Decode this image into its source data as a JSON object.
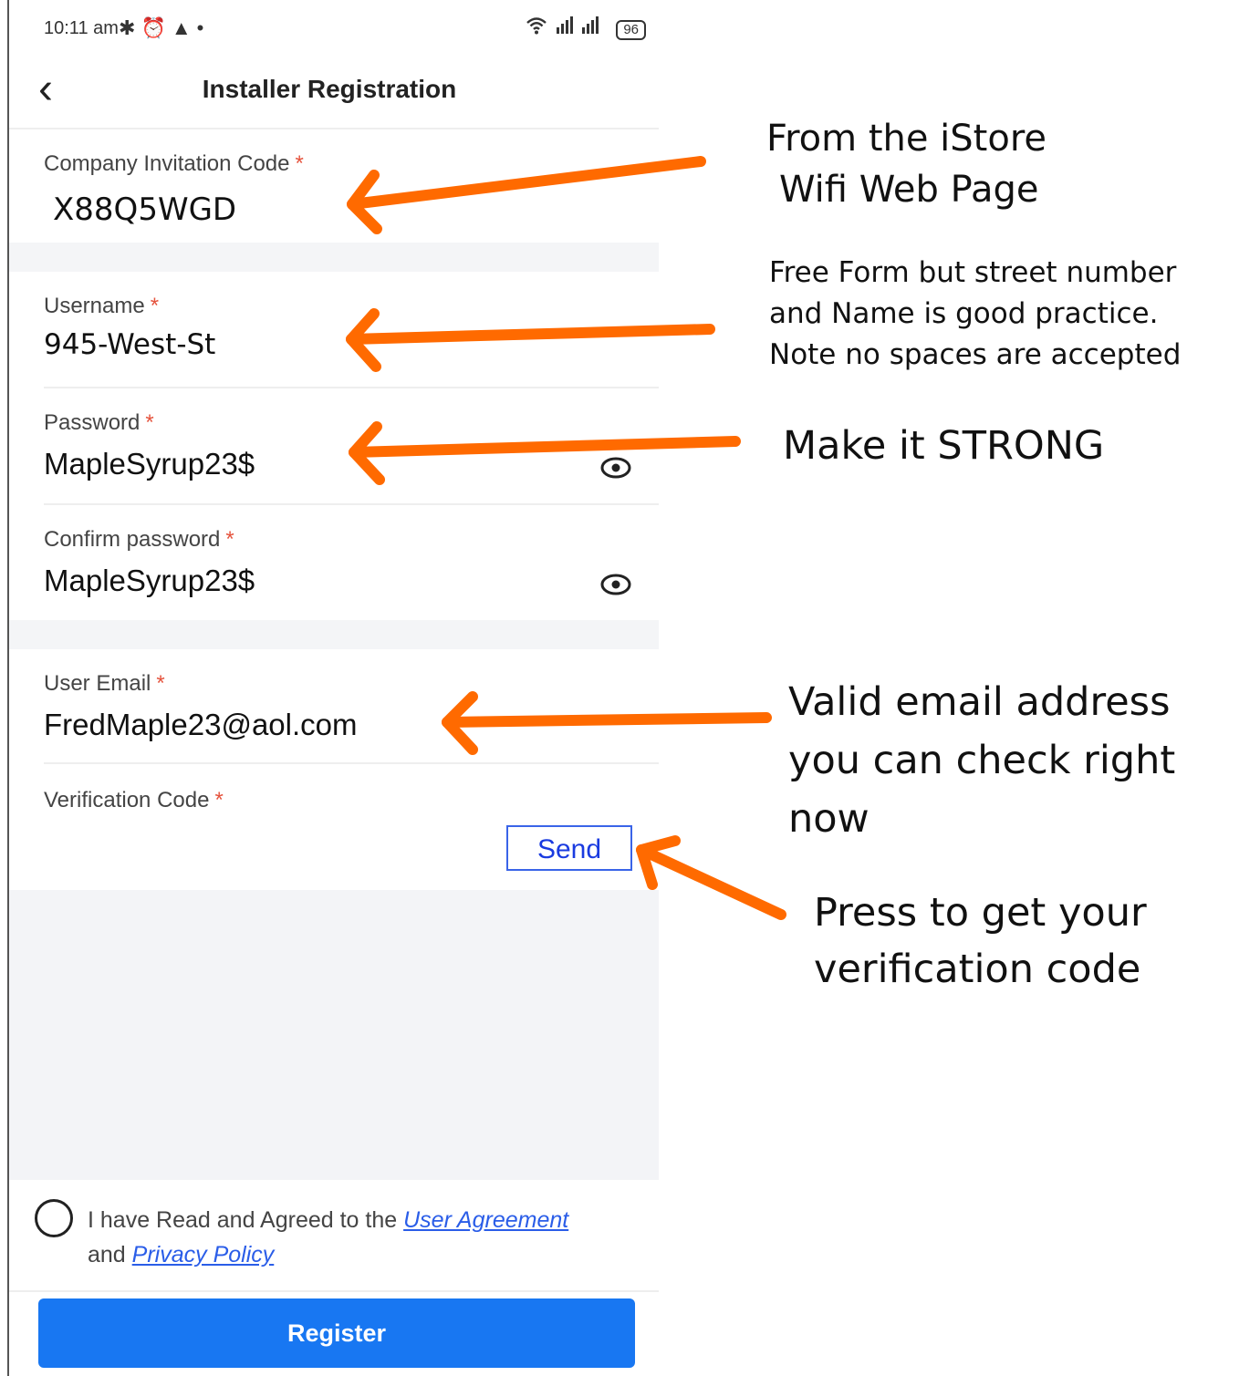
{
  "status_bar": {
    "time": "10:11 am",
    "battery": "96"
  },
  "header": {
    "title": "Installer Registration"
  },
  "form": {
    "invitation": {
      "label": "Company Invitation Code",
      "required_mark": "*",
      "value": "X88Q5WGD"
    },
    "username": {
      "label": "Username",
      "required_mark": "*",
      "value": "945-West-St"
    },
    "password": {
      "label": "Password",
      "required_mark": "*",
      "value": "MapleSyrup23$"
    },
    "confirm_password": {
      "label": "Confirm password",
      "required_mark": "*",
      "value": "MapleSyrup23$"
    },
    "email": {
      "label": "User Email",
      "required_mark": "*",
      "value": "FredMaple23@aol.com"
    },
    "verification": {
      "label": "Verification Code",
      "required_mark": "*",
      "send_label": "Send"
    }
  },
  "agreement": {
    "prefix": "I have Read and Agreed to the",
    "user_agreement": "User Agreement",
    "middle": "and",
    "privacy_policy": "Privacy Policy"
  },
  "register_label": "Register",
  "annotations": {
    "istore_line1": "From the iStore",
    "istore_line2": "Wifi Web Page",
    "username_line1": "Free Form but street number",
    "username_line2": "and Name is good practice.",
    "username_line3": "Note no spaces are accepted",
    "password": "Make it STRONG",
    "email_line1": "Valid email address",
    "email_line2": "you can check right now",
    "send_line1": "Press to get your",
    "send_line2": "verification code"
  },
  "colors": {
    "arrow": "#ff6a00",
    "primary": "#1877f2",
    "required": "#e5533d",
    "link": "#2a5de8"
  },
  "icons": [
    "back-arrow-icon",
    "bluetooth-icon",
    "alarm-icon",
    "warning-icon",
    "wifi-icon",
    "signal-icon",
    "battery-icon",
    "eye-icon"
  ]
}
